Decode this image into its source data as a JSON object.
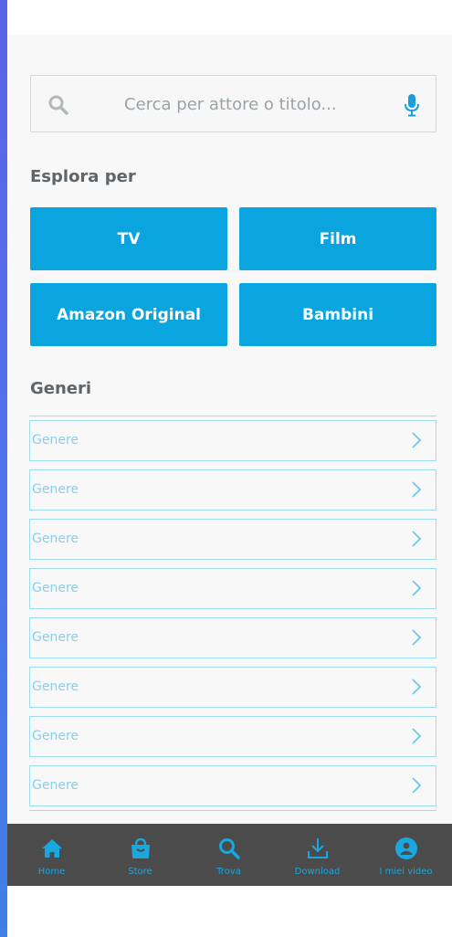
{
  "search": {
    "placeholder": "Cerca per attore o titolo..."
  },
  "explore": {
    "title": "Esplora per",
    "tiles": [
      "TV",
      "Film",
      "Amazon Original",
      "Bambini"
    ]
  },
  "genres": {
    "title": "Generi",
    "items": [
      "Genere",
      "Genere",
      "Genere",
      "Genere",
      "Genere",
      "Genere",
      "Genere",
      "Genere"
    ]
  },
  "nav": {
    "items": [
      {
        "label": "Home",
        "icon": "home-icon"
      },
      {
        "label": "Store",
        "icon": "store-bag-icon"
      },
      {
        "label": "Trova",
        "icon": "search-icon"
      },
      {
        "label": "Download",
        "icon": "download-icon"
      },
      {
        "label": "I miei video",
        "icon": "user-icon"
      }
    ]
  },
  "colors": {
    "accent": "#0aa5de",
    "navbar": "#4b4b4b",
    "genre_text": "#85d0ee",
    "background": "#f8f8f8"
  }
}
